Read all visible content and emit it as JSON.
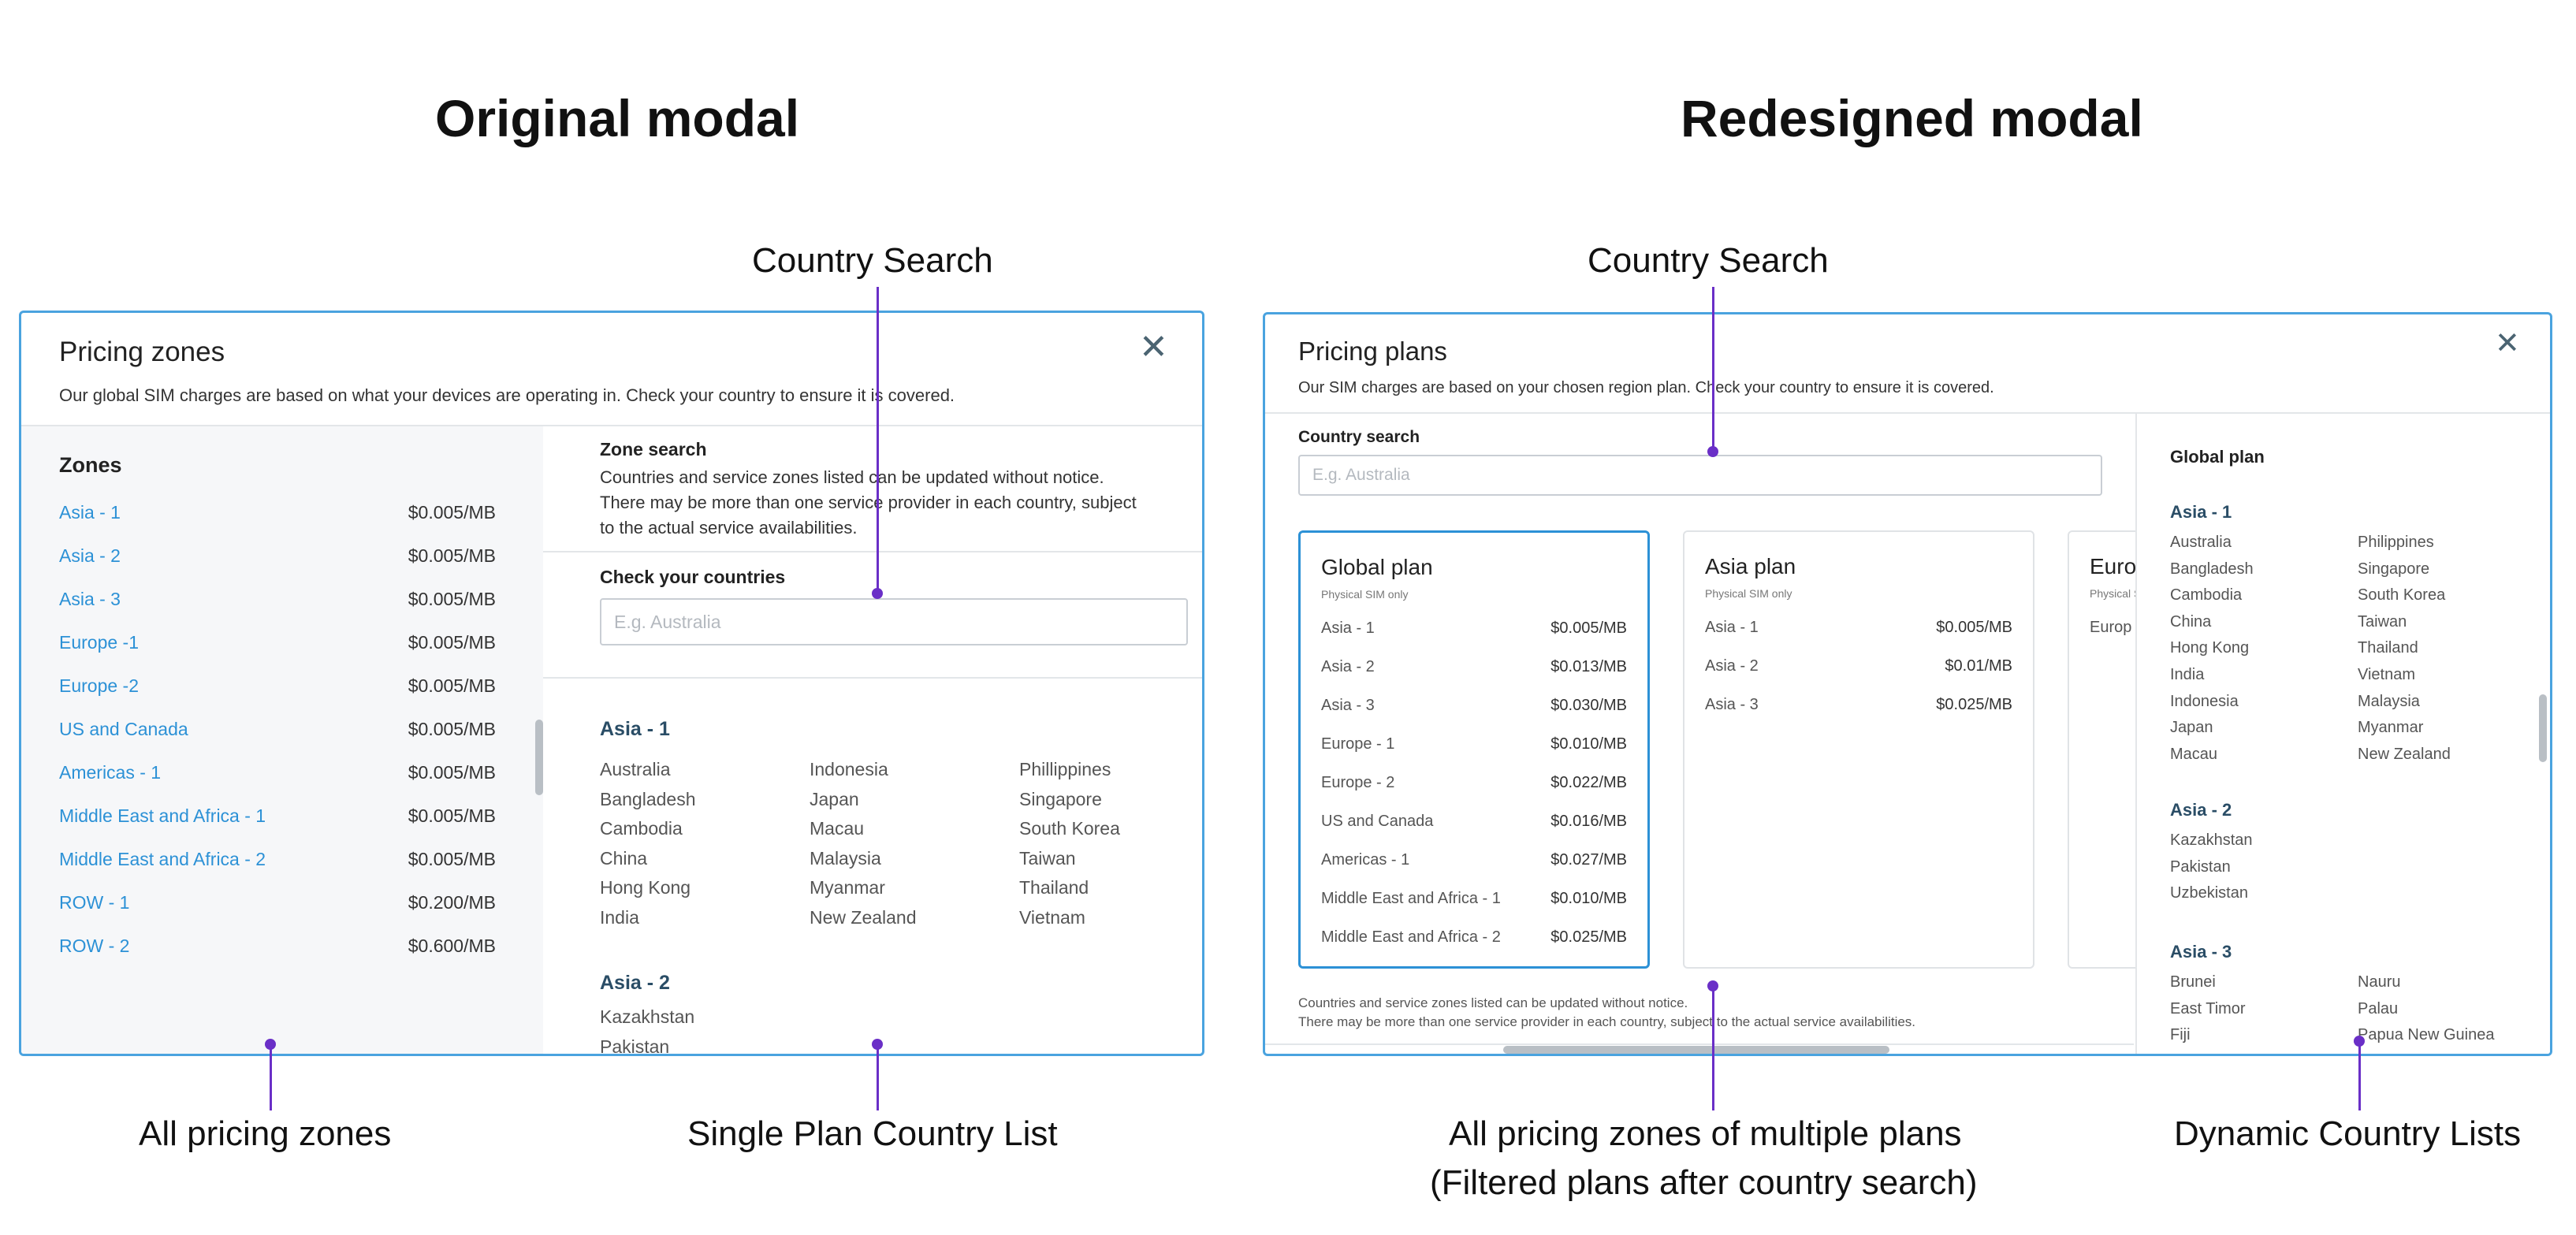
{
  "headings": {
    "original": "Original modal",
    "redesigned": "Redesigned modal"
  },
  "callouts": {
    "left_search": "Country Search",
    "right_search": "Country Search",
    "all_zones": "All pricing zones",
    "single_list": "Single Plan Country List",
    "multi_plans_1": "All pricing zones of multiple plans",
    "multi_plans_2": "(Filtered plans after country search)",
    "dynamic": "Dynamic Country Lists"
  },
  "original": {
    "title": "Pricing zones",
    "subtitle": "Our global SIM charges are based on what your devices are operating in. Check your country to ensure it is covered.",
    "close": "✕",
    "zones_label": "Zones",
    "zones": [
      {
        "name": "Asia - 1",
        "price": "$0.005/MB"
      },
      {
        "name": "Asia - 2",
        "price": "$0.005/MB"
      },
      {
        "name": "Asia - 3",
        "price": "$0.005/MB"
      },
      {
        "name": "Europe -1",
        "price": "$0.005/MB"
      },
      {
        "name": "Europe -2",
        "price": "$0.005/MB"
      },
      {
        "name": "US and Canada",
        "price": "$0.005/MB"
      },
      {
        "name": "Americas - 1",
        "price": "$0.005/MB"
      },
      {
        "name": "Middle East and Africa - 1",
        "price": "$0.005/MB"
      },
      {
        "name": "Middle East and Africa - 2",
        "price": "$0.005/MB"
      },
      {
        "name": "ROW - 1",
        "price": "$0.200/MB"
      },
      {
        "name": "ROW - 2",
        "price": "$0.600/MB"
      }
    ],
    "zone_search_label": "Zone search",
    "notice_1": "Countries and service zones listed can be updated without notice.",
    "notice_2": "There may be more than one service provider in each country, subject",
    "notice_3": "to the actual service availabilities.",
    "check_label": "Check your countries",
    "search_placeholder": "E.g. Australia",
    "group1_label": "Asia - 1",
    "group1_cols": [
      [
        "Australia",
        "Bangladesh",
        "Cambodia",
        "China",
        "Hong Kong",
        "India"
      ],
      [
        "Indonesia",
        "Japan",
        "Macau",
        "Malaysia",
        "Myanmar",
        "New Zealand"
      ],
      [
        "Phillippines",
        "Singapore",
        "South Korea",
        "Taiwan",
        "Thailand",
        "Vietnam"
      ]
    ],
    "group2_label": "Asia - 2",
    "group2_items": [
      "Kazakhstan",
      "Pakistan"
    ]
  },
  "redesigned": {
    "title": "Pricing plans",
    "subtitle": "Our SIM charges are based on your chosen region plan. Check your country to ensure it is covered.",
    "close": "✕",
    "search_label": "Country search",
    "search_placeholder": "E.g. Australia",
    "cards": [
      {
        "title": "Global plan",
        "sub": "Physical SIM only",
        "rows": [
          {
            "name": "Asia - 1",
            "price": "$0.005/MB"
          },
          {
            "name": "Asia - 2",
            "price": "$0.013/MB"
          },
          {
            "name": "Asia - 3",
            "price": "$0.030/MB"
          },
          {
            "name": "Europe - 1",
            "price": "$0.010/MB"
          },
          {
            "name": "Europe - 2",
            "price": "$0.022/MB"
          },
          {
            "name": "US and Canada",
            "price": "$0.016/MB"
          },
          {
            "name": "Americas - 1",
            "price": "$0.027/MB"
          },
          {
            "name": "Middle East and Africa - 1",
            "price": "$0.010/MB"
          },
          {
            "name": "Middle East and Africa - 2",
            "price": "$0.025/MB"
          }
        ]
      },
      {
        "title": "Asia plan",
        "sub": "Physical SIM only",
        "rows": [
          {
            "name": "Asia - 1",
            "price": "$0.005/MB"
          },
          {
            "name": "Asia - 2",
            "price": "$0.01/MB"
          },
          {
            "name": "Asia - 3",
            "price": "$0.025/MB"
          }
        ]
      },
      {
        "title": "Euro",
        "sub": "Physical S",
        "rows": [
          {
            "name": "Europ",
            "price": ""
          }
        ]
      }
    ],
    "notice_1": "Countries and service zones listed can be updated without notice.",
    "notice_2": "There may be more than one service provider in each country, subject to the actual service availabilities.",
    "side_title": "Global plan",
    "side_groups": [
      {
        "label": "Asia - 1",
        "col1": [
          "Australia",
          "Bangladesh",
          "Cambodia",
          "China",
          "Hong Kong",
          "India",
          "Indonesia",
          "Japan",
          "Macau"
        ],
        "col2": [
          "Philippines",
          "Singapore",
          "South Korea",
          "Taiwan",
          "Thailand",
          "Vietnam",
          "Malaysia",
          "Myanmar",
          "New Zealand"
        ]
      },
      {
        "label": "Asia - 2",
        "col1": [
          "Kazakhstan",
          "Pakistan",
          "Uzbekistan"
        ],
        "col2": []
      },
      {
        "label": "Asia - 3",
        "col1": [
          "Brunei",
          "East Timor",
          "Fiji"
        ],
        "col2": [
          "Nauru",
          "Palau",
          "Papua New Guinea"
        ]
      }
    ]
  }
}
